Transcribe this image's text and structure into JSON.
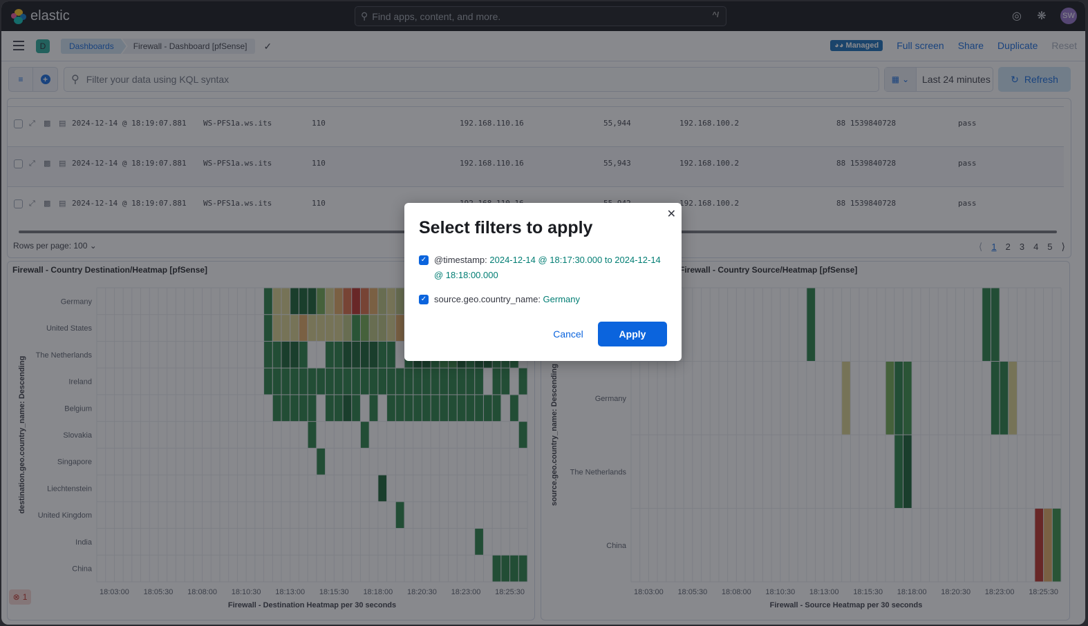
{
  "topbar": {
    "brand": "elastic",
    "search_placeholder": "Find apps, content, and more.",
    "search_shortcut": "^/",
    "avatar_initials": "SW",
    "icons": [
      "help-icon",
      "news-feed-icon"
    ]
  },
  "appbar": {
    "space_initial": "D",
    "breadcrumbs": [
      "Dashboards",
      "Firewall - Dashboard [pfSense]"
    ],
    "managed_badge": "Managed",
    "actions": [
      "Full screen",
      "Share",
      "Duplicate",
      "Reset"
    ]
  },
  "querybar": {
    "kql_placeholder": "Filter your data using KQL syntax",
    "time_range": "Last 24 minutes",
    "refresh_label": "Refresh"
  },
  "table": {
    "rows": [
      {
        "timestamp": "2024-12-14 @ 18:19:07.881",
        "host": "WS-PFS1a.ws.its",
        "rule": "110",
        "src_ip": "192.168.110.16",
        "src_port": "55,944",
        "dst_ip": "192.168.100.2",
        "tracker": "88 1539840728",
        "action": "pass"
      },
      {
        "timestamp": "2024-12-14 @ 18:19:07.881",
        "host": "WS-PFS1a.ws.its",
        "rule": "110",
        "src_ip": "192.168.110.16",
        "src_port": "55,943",
        "dst_ip": "192.168.100.2",
        "tracker": "88 1539840728",
        "action": "pass"
      },
      {
        "timestamp": "2024-12-14 @ 18:19:07.881",
        "host": "WS-PFS1a.ws.its",
        "rule": "110",
        "src_ip": "192.168.110.16",
        "src_port": "55,942",
        "dst_ip": "192.168.100.2",
        "tracker": "88 1539840728",
        "action": "pass"
      }
    ],
    "rows_per_page": "Rows per page: 100",
    "pages": [
      "1",
      "2",
      "3",
      "4",
      "5"
    ],
    "current_page": "1"
  },
  "error_badge": {
    "count": "1"
  },
  "modal": {
    "title": "Select filters to apply",
    "filters": [
      {
        "field": "@timestamp: ",
        "value": "2024-12-14 @ 18:17:30.000 to 2024-12-14 @ 18:18:00.000",
        "checked": true
      },
      {
        "field": "source.geo.country_name: ",
        "value": "Germany",
        "checked": true
      }
    ],
    "cancel_label": "Cancel",
    "apply_label": "Apply"
  },
  "colors": {
    "accent": "#0b64dd",
    "heat": [
      "#1e7a3d",
      "#0d5a28",
      "#2f8a3e",
      "#6aa64a",
      "#b9c27a",
      "#d8cf88",
      "#e0a55c",
      "#d9663c",
      "#b8261e"
    ]
  },
  "chart_data": [
    {
      "type": "heatmap",
      "title": "Firewall - Country Destination/Heatmap [pfSense]",
      "xlabel": "Firewall - Destination Heatmap per 30 seconds",
      "ylabel": "destination.geo.country_name: Descending",
      "x_start": "18:02:00",
      "x_interval_seconds": 30,
      "x_count": 49,
      "x_ticks": [
        "18:03:00",
        "18:05:30",
        "18:08:00",
        "18:10:30",
        "18:13:00",
        "18:15:30",
        "18:18:00",
        "18:20:30",
        "18:23:00",
        "18:25:30"
      ],
      "y_categories": [
        "Germany",
        "United States",
        "The Netherlands",
        "Ireland",
        "Belgium",
        "Slovakia",
        "Singapore",
        "Liechtenstein",
        "United Kingdom",
        "India",
        "China"
      ],
      "intensity_scale": "0 (low, dark green) to 8 (high, red)",
      "cells": [
        [
          [
            19,
            0
          ],
          [
            20,
            5
          ],
          [
            21,
            5
          ],
          [
            22,
            1
          ],
          [
            23,
            1
          ],
          [
            24,
            1
          ],
          [
            25,
            3
          ],
          [
            26,
            5
          ],
          [
            27,
            6
          ],
          [
            28,
            7
          ],
          [
            29,
            8
          ],
          [
            30,
            7
          ],
          [
            31,
            6
          ],
          [
            32,
            4
          ],
          [
            33,
            5
          ],
          [
            34,
            4
          ],
          [
            35,
            4
          ],
          [
            36,
            5
          ],
          [
            37,
            4
          ],
          [
            38,
            3
          ],
          [
            39,
            4
          ],
          [
            40,
            5
          ],
          [
            41,
            3
          ],
          [
            42,
            2
          ],
          [
            43,
            3
          ],
          [
            44,
            5
          ],
          [
            45,
            4
          ],
          [
            46,
            3
          ],
          [
            47,
            4
          ]
        ],
        [
          [
            19,
            0
          ],
          [
            20,
            5
          ],
          [
            21,
            5
          ],
          [
            22,
            5
          ],
          [
            23,
            6
          ],
          [
            24,
            5
          ],
          [
            25,
            5
          ],
          [
            26,
            5
          ],
          [
            27,
            5
          ],
          [
            28,
            4
          ],
          [
            29,
            2
          ],
          [
            30,
            3
          ],
          [
            31,
            4
          ],
          [
            32,
            4
          ],
          [
            33,
            5
          ],
          [
            34,
            6
          ],
          [
            35,
            4
          ],
          [
            36,
            4
          ],
          [
            37,
            5
          ],
          [
            38,
            3
          ],
          [
            39,
            4
          ],
          [
            40,
            5
          ],
          [
            41,
            4
          ],
          [
            42,
            3
          ],
          [
            43,
            4
          ],
          [
            44,
            5
          ],
          [
            45,
            3
          ]
        ],
        [
          [
            19,
            0
          ],
          [
            20,
            0
          ],
          [
            21,
            1
          ],
          [
            22,
            1
          ],
          [
            23,
            0
          ],
          [
            26,
            0
          ],
          [
            27,
            0
          ],
          [
            28,
            1
          ],
          [
            29,
            1
          ],
          [
            30,
            1
          ],
          [
            31,
            1
          ],
          [
            32,
            0
          ],
          [
            33,
            0
          ],
          [
            35,
            0
          ],
          [
            36,
            1
          ],
          [
            37,
            1
          ],
          [
            38,
            0
          ],
          [
            39,
            2
          ],
          [
            40,
            2
          ],
          [
            41,
            1
          ],
          [
            42,
            0
          ],
          [
            43,
            1
          ],
          [
            44,
            1
          ],
          [
            45,
            0
          ],
          [
            46,
            0
          ],
          [
            47,
            0
          ]
        ],
        [
          [
            19,
            0
          ],
          [
            20,
            0
          ],
          [
            21,
            0
          ],
          [
            22,
            0
          ],
          [
            23,
            0
          ],
          [
            24,
            0
          ],
          [
            25,
            0
          ],
          [
            26,
            0
          ],
          [
            27,
            0
          ],
          [
            28,
            0
          ],
          [
            29,
            0
          ],
          [
            30,
            0
          ],
          [
            31,
            0
          ],
          [
            32,
            0
          ],
          [
            33,
            0
          ],
          [
            34,
            0
          ],
          [
            35,
            0
          ],
          [
            36,
            0
          ],
          [
            37,
            0
          ],
          [
            38,
            0
          ],
          [
            39,
            0
          ],
          [
            40,
            0
          ],
          [
            41,
            0
          ],
          [
            42,
            0
          ],
          [
            43,
            0
          ],
          [
            45,
            0
          ],
          [
            46,
            0
          ],
          [
            48,
            0
          ],
          [
            49,
            0
          ]
        ],
        [
          [
            20,
            0
          ],
          [
            21,
            0
          ],
          [
            22,
            0
          ],
          [
            23,
            0
          ],
          [
            24,
            0
          ],
          [
            26,
            0
          ],
          [
            27,
            0
          ],
          [
            28,
            1
          ],
          [
            29,
            0
          ],
          [
            31,
            0
          ],
          [
            33,
            0
          ],
          [
            34,
            0
          ],
          [
            35,
            0
          ],
          [
            36,
            0
          ],
          [
            37,
            0
          ],
          [
            38,
            0
          ],
          [
            39,
            0
          ],
          [
            40,
            0
          ],
          [
            41,
            0
          ],
          [
            42,
            0
          ],
          [
            43,
            0
          ],
          [
            44,
            0
          ],
          [
            45,
            0
          ],
          [
            47,
            0
          ]
        ],
        [
          [
            24,
            0
          ],
          [
            30,
            0
          ],
          [
            49,
            0
          ]
        ],
        [
          [
            25,
            0
          ]
        ],
        [
          [
            32,
            1
          ]
        ],
        [
          [
            34,
            0
          ]
        ],
        [
          [
            43,
            0
          ]
        ],
        [
          [
            45,
            0
          ],
          [
            46,
            0
          ],
          [
            47,
            0
          ],
          [
            48,
            0
          ]
        ]
      ]
    },
    {
      "type": "heatmap",
      "title": "Firewall - Country Source/Heatmap [pfSense]",
      "title_visible_fragment": "pfSense]",
      "xlabel": "Firewall - Source Heatmap per 30 seconds",
      "ylabel": "source.geo.country_name: Descending",
      "x_start": "18:02:00",
      "x_interval_seconds": 30,
      "x_count": 49,
      "x_ticks": [
        "18:03:00",
        "18:05:30",
        "18:08:00",
        "18:10:30",
        "18:13:00",
        "18:15:30",
        "18:18:00",
        "18:20:30",
        "18:23:00",
        "18:25:30"
      ],
      "y_categories": [
        "",
        "Germany",
        "The Netherlands",
        "China"
      ],
      "intensity_scale": "0 (low, dark green) to 8 (high, red)",
      "cells": [
        [
          [
            20,
            0
          ],
          [
            40,
            0
          ],
          [
            41,
            0
          ]
        ],
        [
          [
            24,
            5
          ],
          [
            29,
            3
          ],
          [
            30,
            0
          ],
          [
            31,
            2
          ],
          [
            41,
            0
          ],
          [
            42,
            0
          ],
          [
            43,
            5
          ]
        ],
        [
          [
            30,
            0
          ],
          [
            31,
            1
          ]
        ],
        [
          [
            46,
            8
          ],
          [
            47,
            6
          ],
          [
            48,
            2
          ]
        ]
      ]
    }
  ]
}
